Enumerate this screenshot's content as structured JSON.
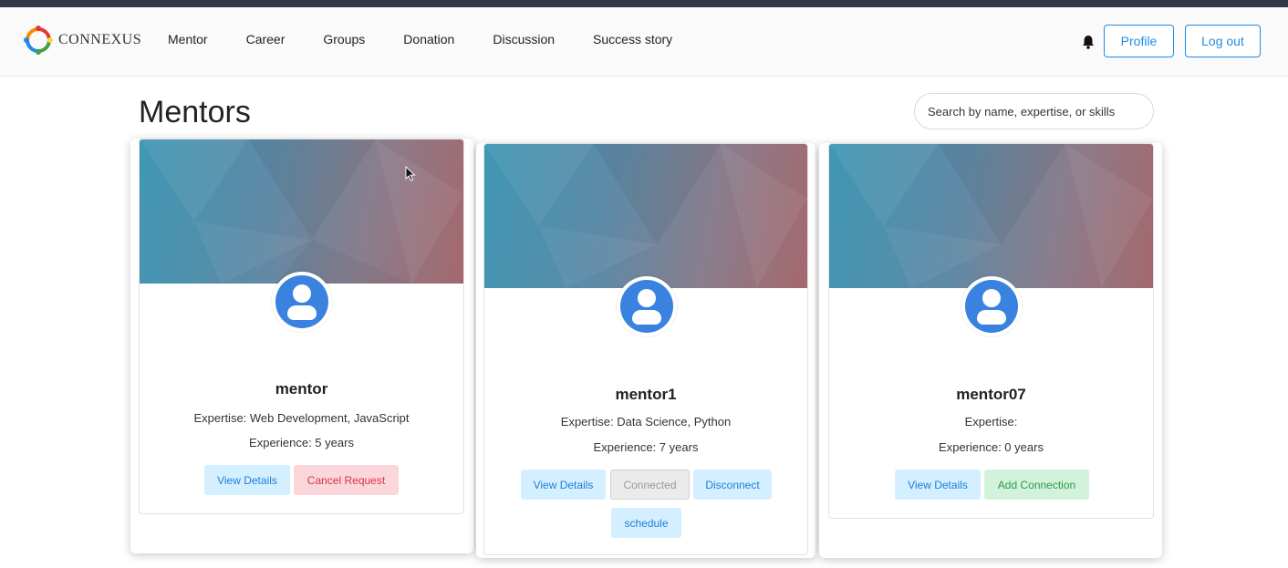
{
  "brand": {
    "name": "CONNEXUS"
  },
  "nav": {
    "items": [
      "Mentor",
      "Career",
      "Groups",
      "Donation",
      "Discussion",
      "Success story"
    ]
  },
  "header": {
    "profile_label": "Profile",
    "logout_label": "Log out"
  },
  "page": {
    "title": "Mentors"
  },
  "search": {
    "placeholder": "Search by name, expertise, or skills"
  },
  "mentors": [
    {
      "name": "mentor",
      "expertise": "Expertise: Web Development, JavaScript",
      "experience": "Experience: 5 years",
      "actions": [
        "View Details",
        "Cancel Request"
      ]
    },
    {
      "name": "mentor1",
      "expertise": "Expertise: Data Science, Python",
      "experience": "Experience: 7 years",
      "actions": [
        "View Details",
        "Connected",
        "Disconnect",
        "schedule"
      ]
    },
    {
      "name": "mentor07",
      "expertise": "Expertise:",
      "experience": "Experience: 0 years",
      "actions": [
        "View Details",
        "Add Connection"
      ]
    }
  ],
  "colors": {
    "accent": "#1d8ce8",
    "avatar": "#3a82e0",
    "danger": "#d6334a",
    "success": "#2a9c47"
  }
}
